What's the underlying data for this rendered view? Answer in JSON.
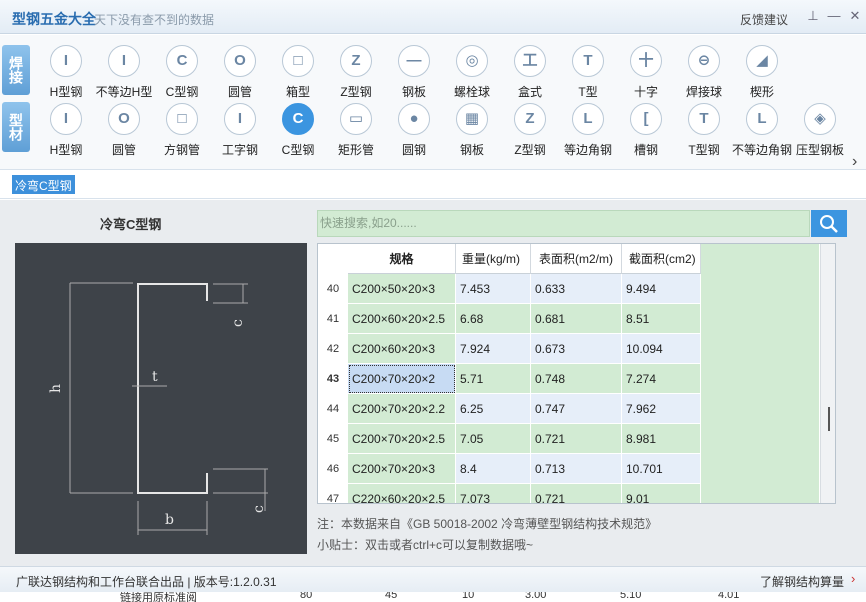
{
  "titlebar": {
    "title": "型钢五金大全",
    "subtitle": "天下没有查不到的数据",
    "feedback": "反馈建议"
  },
  "weld_tab": {
    "label": "焊接"
  },
  "profile_tab": {
    "label": "型材"
  },
  "weld_items": [
    {
      "label": "H型钢",
      "glyph": "I"
    },
    {
      "label": "不等边H型",
      "glyph": "I"
    },
    {
      "label": "C型钢",
      "glyph": "C"
    },
    {
      "label": "圆管",
      "glyph": "O"
    },
    {
      "label": "箱型",
      "glyph": "□"
    },
    {
      "label": "Z型钢",
      "glyph": "Z"
    },
    {
      "label": "钢板",
      "glyph": "—"
    },
    {
      "label": "螺栓球",
      "glyph": "◎"
    },
    {
      "label": "盒式",
      "glyph": "工"
    },
    {
      "label": "T型",
      "glyph": "T"
    },
    {
      "label": "十字",
      "glyph": "十"
    },
    {
      "label": "焊接球",
      "glyph": "⊖"
    },
    {
      "label": "楔形",
      "glyph": "◢"
    }
  ],
  "profile_items": [
    {
      "label": "H型钢",
      "glyph": "I"
    },
    {
      "label": "圆管",
      "glyph": "O"
    },
    {
      "label": "方钢管",
      "glyph": "□"
    },
    {
      "label": "工字钢",
      "glyph": "I"
    },
    {
      "label": "C型钢",
      "glyph": "C"
    },
    {
      "label": "矩形管",
      "glyph": "▭"
    },
    {
      "label": "圆钢",
      "glyph": "●"
    },
    {
      "label": "钢板",
      "glyph": "▦"
    },
    {
      "label": "Z型钢",
      "glyph": "Z"
    },
    {
      "label": "等边角钢",
      "glyph": "L"
    },
    {
      "label": "槽钢",
      "glyph": "["
    },
    {
      "label": "T型钢",
      "glyph": "T"
    },
    {
      "label": "不等边角钢",
      "glyph": "L"
    },
    {
      "label": "压型钢板",
      "glyph": "◈"
    }
  ],
  "profile_active_index": 4,
  "breadcrumb": "冷弯C型钢",
  "diagram": {
    "title": "冷弯C型钢",
    "label_h": "h",
    "label_t": "t",
    "label_b": "b",
    "label_c_top": "c",
    "label_c_bottom": "c"
  },
  "search": {
    "placeholder": "快速搜索,如20......"
  },
  "table": {
    "headers": [
      "规格",
      "重量(kg/m)",
      "表面积(m2/m)",
      "截面积(cm2)"
    ],
    "selected_row": 43,
    "rows": [
      {
        "idx": "40",
        "spec": "C200×50×20×3",
        "weight": "7.453",
        "surface": "0.633",
        "section": "9.494"
      },
      {
        "idx": "41",
        "spec": "C200×60×20×2.5",
        "weight": "6.68",
        "surface": "0.681",
        "section": "8.51"
      },
      {
        "idx": "42",
        "spec": "C200×60×20×3",
        "weight": "7.924",
        "surface": "0.673",
        "section": "10.094"
      },
      {
        "idx": "43",
        "spec": "C200×70×20×2",
        "weight": "5.71",
        "surface": "0.748",
        "section": "7.274"
      },
      {
        "idx": "44",
        "spec": "C200×70×20×2.2",
        "weight": "6.25",
        "surface": "0.747",
        "section": "7.962"
      },
      {
        "idx": "45",
        "spec": "C200×70×20×2.5",
        "weight": "7.05",
        "surface": "0.721",
        "section": "8.981"
      },
      {
        "idx": "46",
        "spec": "C200×70×20×3",
        "weight": "8.4",
        "surface": "0.713",
        "section": "10.701"
      },
      {
        "idx": "47",
        "spec": "C220×60×20×2.5",
        "weight": "7.073",
        "surface": "0.721",
        "section": "9.01"
      }
    ]
  },
  "notes": {
    "source": "注：本数据来自《GB  50018-2002  冷弯薄壁型钢结构技术规范》",
    "tip": "小贴士：双击或者ctrl+c可以复制数据哦~"
  },
  "status": {
    "left": "广联达钢结构和工作台联合出品  |  版本号:1.2.0.31",
    "right": "了解钢结构算量"
  },
  "background_strip": [
    "链接用原标准阅",
    "80",
    "45",
    "10",
    "3.00",
    "5.10",
    "4.01"
  ]
}
